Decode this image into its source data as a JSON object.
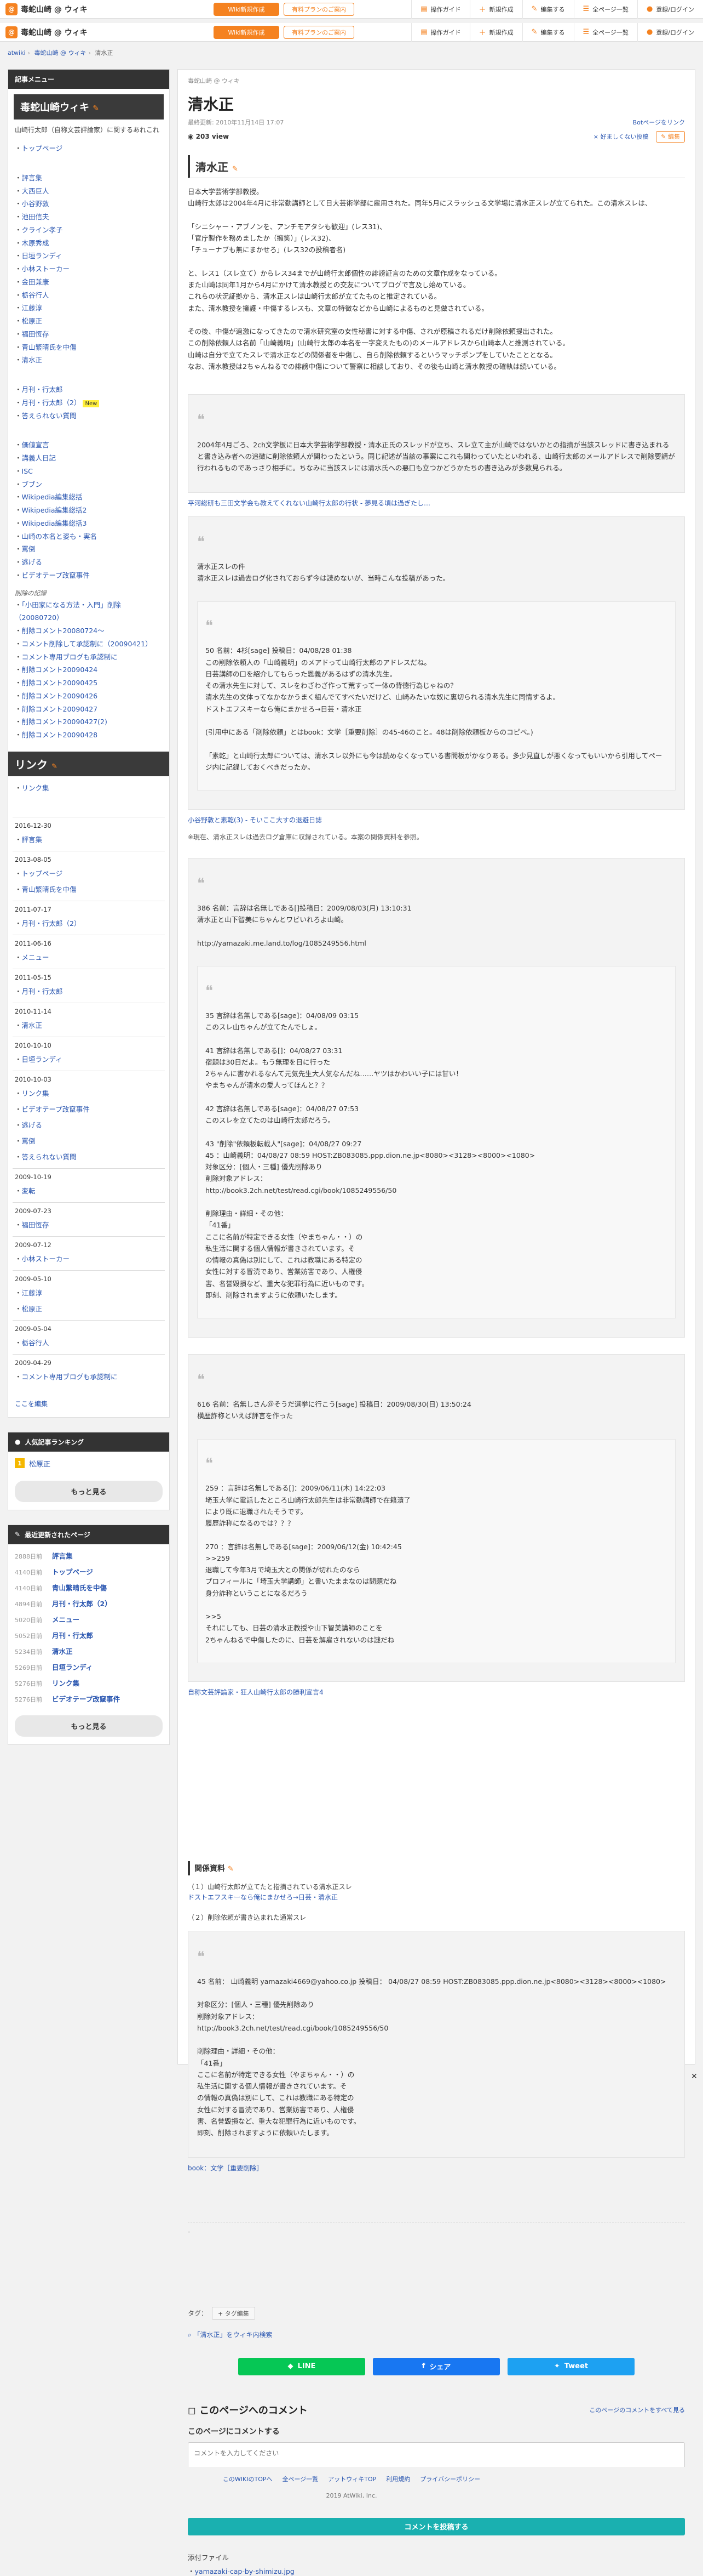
{
  "site": {
    "logo_mark": "@",
    "name": "毒蛇山崎 @ ウィキ",
    "btn_new": "Wiki新規作成",
    "btn_pro": "有料プランのご案内",
    "tools": [
      "操作ガイド",
      "新規作成",
      "編集する",
      "全ページ一覧",
      "登録/ログイン"
    ]
  },
  "breadcrumb": [
    "atwiki",
    "毒蛇山崎 @ ウィキ",
    "清水正"
  ],
  "sidebar": {
    "menu_head": "記事メニュー",
    "wiki_title": "毒蛇山崎ウィキ",
    "desc": "山崎行太郎（自称文芸評論家）に関するあれこれ",
    "items_top": [
      "トップページ"
    ],
    "items_people": [
      "評言集",
      "大西巨人",
      "小谷野敦",
      "池田信夫",
      "クライン孝子",
      "木原秀成",
      "日垣ランディ",
      "小林ストーカー",
      "金田兼康",
      "栃谷行人",
      "江藤淳",
      "松原正",
      "福田恆存",
      "青山繁晴氏を中傷",
      "清水正"
    ],
    "items_mid": [
      "月刊・行太郎",
      "月刊・行太郎（2）",
      "答えられない質問"
    ],
    "new_label": "New",
    "items_misc": [
      "価値宣言",
      "講義人日記",
      "ISC",
      "ブブン",
      "Wikipedia編集総括",
      "Wikipedia編集総括2",
      "Wikipedia編集総括3",
      "山崎の本名と姿も・実名",
      "罵倒",
      "逃げる",
      "ビデオテープ改竄事件"
    ],
    "record_head": "削除の記録",
    "items_records": [
      "「小田家になる方法・入門」削除（20080720）",
      "削除コメント20080724〜",
      "コメント削除して承認制に（20090421）",
      "コメント専用ブログも承認制に",
      "削除コメント20090424",
      "削除コメント20090425",
      "削除コメント20090426",
      "削除コメント20090427",
      "削除コメント20090427(2)",
      "削除コメント20090428"
    ],
    "link_head": "リンク",
    "link_items": [
      "リンク集"
    ],
    "history": [
      {
        "date": "2016-12-30",
        "items": [
          "評言集"
        ]
      },
      {
        "date": "2013-08-05",
        "items": [
          "トップページ",
          "青山繁晴氏を中傷"
        ]
      },
      {
        "date": "2011-07-17",
        "items": [
          "月刊・行太郎（2）"
        ]
      },
      {
        "date": "2011-06-16",
        "items": [
          "メニュー"
        ]
      },
      {
        "date": "2011-05-15",
        "items": [
          "月刊・行太郎"
        ]
      },
      {
        "date": "2010-11-14",
        "items": [
          "清水正"
        ]
      },
      {
        "date": "2010-10-10",
        "items": [
          "日垣ランディ"
        ]
      },
      {
        "date": "2010-10-03",
        "items": [
          "リンク集",
          "ビデオテープ改竄事件",
          "逃げる",
          "罵倒",
          "答えられない質問"
        ]
      },
      {
        "date": "2009-10-19",
        "items": [
          "変転"
        ]
      },
      {
        "date": "2009-07-23",
        "items": [
          "福田恆存"
        ]
      },
      {
        "date": "2009-07-12",
        "items": [
          "小林ストーカー"
        ]
      },
      {
        "date": "2009-05-10",
        "items": [
          "江藤淳",
          "松原正"
        ]
      },
      {
        "date": "2009-05-04",
        "items": [
          "栃谷行人"
        ]
      },
      {
        "date": "2009-04-29",
        "items": [
          "コメント専用ブログも承認制に"
        ]
      }
    ],
    "edit_here": "ここを編集",
    "rank_head": "人気記事ランキング",
    "rank": [
      {
        "num": "1",
        "title": "松原正"
      }
    ],
    "more": "もっと見る",
    "recent_head": "最近更新されたページ",
    "recent": [
      {
        "d": "2888日前",
        "t": "評言集"
      },
      {
        "d": "4140日前",
        "t": "トップページ"
      },
      {
        "d": "4140日前",
        "t": "青山繁晴氏を中傷"
      },
      {
        "d": "4894日前",
        "t": "月刊・行太郎（2）"
      },
      {
        "d": "5020日前",
        "t": "メニュー"
      },
      {
        "d": "5052日前",
        "t": "月刊・行太郎"
      },
      {
        "d": "5234日前",
        "t": "清水正"
      },
      {
        "d": "5269日前",
        "t": "日垣ランディ"
      },
      {
        "d": "5276日前",
        "t": "リンク集"
      },
      {
        "d": "5276日前",
        "t": "ビデオテープ改竄事件"
      }
    ]
  },
  "main": {
    "wikiname": "毒蛇山崎 @ ウィキ",
    "title": "清水正",
    "updated": "最終更新: 2010年11月14日 17:07",
    "author_label": "Botページをリンク",
    "views_label": "203 view",
    "report": "× 好ましくない投稿",
    "edit": "編集",
    "h2": "清水正",
    "para1": "日本大学芸術学部教授。\n山崎行太郎は2004年4月に非常勤講師として日大芸術学部に雇用された。同年5月にスラッシュる文学場に清水正スレが立てられた。この清水スレは、\n\n「シニシャー・アブノンを、アンチモアタシも歓迎」(レス31)、\n「官庁製作を務めましたか（擁笑）」(レス32)、\n「チューナブも無にまかせろ」(レス32の投稿者名)\n\nと、レス1（スレ立て）からレス34までが山崎行太郎個性の誹謗証言のための文章作成をなっている。\nまた山崎は同年1月から4月にかけて清水教授との交友についてブログで言及し始めている。\nこれらの状況証拠から、清水正スレは山崎行太郎が立てたものと推定されている。\nまた、清水教授を擁護・中傷するレスも、文章の特徴などから山崎によるものと見做されている。\n\nその後、中傷が過激になってきたので清水研究室の女性秘書に対する中傷、されが原稿されるだけ削除依頼提出された。\nこの削除依頼人は名前「山崎義明」(山崎行太郎の本名を一字変えたもの)のメールアドレスから山崎本人と推測されている。\n山崎は自分で立てたスレで清水正などの関係者を中傷し、自ら削除依頼するというマッチポンプをしていたこととなる。\nなお、清水教授は2ちゃんねるでの誹謗中傷について警察に相談しており、その後も山崎と清水教授の確執は続いている。",
    "quote1": "2004年4月ごろ、2ch文学板に日本大学芸術学部教授・清水正氏のスレッドが立ち、スレ立て主が山崎ではないかとの指摘が当該スレッドに書き込まれると書き込み者への追徴に削除依頼人が関わったという。同じ記述が当該の事案にこれも関わっていたといわれる、山崎行太郎のメールアドレスで削除要請が行われるものであっさり相手に。ちなみに当該スレには清水氏への悪口も立つかどうかたちの書き込みが多数見られる。",
    "src1": "平河総研も三田文学会も教えてくれない山崎行太郎の行状 - 夢見る頃は過ぎたし…",
    "quote2": "清水正スレの件\n清水正スレは過去ログ化されておらず今は読めないが、当時こんな投稿があった。",
    "inner2": "50 名前：4杉[sage] 投稿日：04/08/28 01:38\nこの削除依頼人の「山崎義明」のメアドって山崎行太郎のアドレスだね。\n日芸講師の口を紹介してもらった恩義があるはずの清水先生。\nその清水先生に対して、スレをわざわざ作って荒すって一体の背徳行為じゃねの？\n清水先生の文体ってなかなかうまく組んでてすべたいだけど、山崎みたいな奴に裏切られる清水先生に同情するよ。\nドストエフスキーなら俺にまかせろ→日芸・清水正\n\n(引用中にある「削除依頼」とはbook：文学［重要削除］の45-46のこと。48は削除依頼板からのコピペ。)\n\n「素乾」と山崎行太郎については、清水スレ以外にも今は読めなくなっている書間板がかなりある。多少見直しが悪くなってもいいから引用してページ内に記録しておくべきだったか。",
    "src2": "小谷野敦と素乾(3) - そいここ大すの退避日誌",
    "note1": "※現在、清水正スレは過去ログ倉庫に収録されている。本案の関係資料を参照。",
    "quote3": "386 名前：言辞は名無しである[]投稿日：2009/08/03(月) 13:10:31\n清水正と山下智美にちゃんとワビいれろよ山崎。\n\nhttp://yamazaki.me.land.to/log/1085249556.html",
    "inner3": "35 言辞は名無しである[sage]：04/08/09 03:15\nこのスレ山ちゃんが立てたんでしょ。\n\n41 言辞は名無しである[]：04/08/27 03:31\n宿題は30日だよ。もう無理を日に行った\n2ちゃんに書かれるなんて元気先生大人気なんだね……ヤツはかわいい子には甘い！\nやまちゃんが清水の愛人ってほんと？？\n\n42 言辞は名無しである[sage]：04/08/27 07:53\nこのスレを立てたのは山崎行太郎だろう。\n\n43 \"削除\"依頼板転載人\"[sage]：04/08/27 09:27\n45 ：山崎義明：04/08/27 08:59 HOST:ZB083085.ppp.dion.ne.jp<8080><3128><8000><1080>\n対象区分：[個人・三種] 優先削除あり\n削除対象アドレス：\nhttp://book3.2ch.net/test/read.cgi/book/1085249556/50\n\n削除理由・詳細・その他：\n「41番」\nここに名前が特定できる女性（やまちゃん・・）の\n私生活に関する個人情報が書きされています。そ\nの情報の真偽は別にして、これは教職にある特定の\n女性に対する冒涜であり、営業妨害であり、人権侵\n害、名誉毀損など、重大な犯罪行為に近いものです。\n即刻、削除されますように依頼いたします。",
    "quote4": "616 名前：名無しさん＠そうだ選挙に行こう[sage] 投稿日：2009/08/30(日) 13:50:24\n横歴詐称といえば評言を作った\n",
    "inner4": "259 ：言辞は名無しである[]：2009/06/11(木) 14:22:03\n埼玉大学に電話したところ山崎行太郎先生は非常勤講師で在籍漬了\nにより既に退職されたそうです。\n履歴詐称になるのでは？？？\n\n270 ：言辞は名無しである[sage]：2009/06/12(金) 10:42:45\n>>259\n退職して今年3月で埼玉大との関係が切れたのなら\nプロフィールに「埼玉大学講師」と書いたままなのは問題だね\n身分詐称ということになるだろう\n\n>>5\nそれにしても、日芸の清水正教授や山下智美講師のことを\n2ちゃんねるで中傷したのに、日芸を解雇されないのは謎だね",
    "src4": "自称文芸評論家・狂人山崎行太郎の勝利宣言4",
    "h3": "関係資料",
    "rel1": "（１）山崎行太郎が立てたと指摘されている清水正スレ",
    "rel1_link": "ドストエフスキーなら俺にまかせろ→日芸・清水正",
    "rel2": "（２）削除依頼が書き込まれた通常スレ",
    "quote5": "45 名前： 山崎義明 yamazaki4669@yahoo.co.jp 投稿日： 04/08/27 08:59 HOST:ZB083085.ppp.dion.ne.jp<8080><3128><8000><1080>\n\n対象区分：[個人・三種] 優先削除あり\n削除対象アドレス：\nhttp://book3.2ch.net/test/read.cgi/book/1085249556/50\n\n削除理由・詳細・その他：\n「41番」\nここに名前が特定できる女性（やまちゃん・・）の\n私生活に関する個人情報が書きされています。そ\nの情報の真偽は別にして、これは教職にある特定の\n女性に対する冒涜であり、営業妨害であり、人権侵\n害、名誉毀損など、重大な犯罪行為に近いものです。\n即刻、削除されますように依頼いたします。",
    "book_link": "book：文学［重要削除］",
    "dash": "-",
    "tag_label": "タグ：",
    "tag_btn": "+ タグ編集",
    "tag_search": "「清水正」をウィキ内検索",
    "share_line": "LINE",
    "share_fb": "シェア",
    "share_tw": "Tweet",
    "comment_head": "このページへのコメント",
    "comment_all": "このページのコメントをすべて見る",
    "comment_label": "このページにコメントする",
    "comment_ph": "コメントを入力してください",
    "comment_submit": "コメントを投稿する",
    "attach_label": "添付ファイル",
    "attach_file": "yamazaki-cap-by-shimizu.jpg"
  },
  "footer": {
    "links": [
      "このWIKIのTOPへ",
      "全ページ一覧",
      "アットウィキTOP",
      "利用規約",
      "プライバシーポリシー"
    ],
    "copy": "2019 AtWiki, Inc."
  },
  "close_glyph": "✕"
}
